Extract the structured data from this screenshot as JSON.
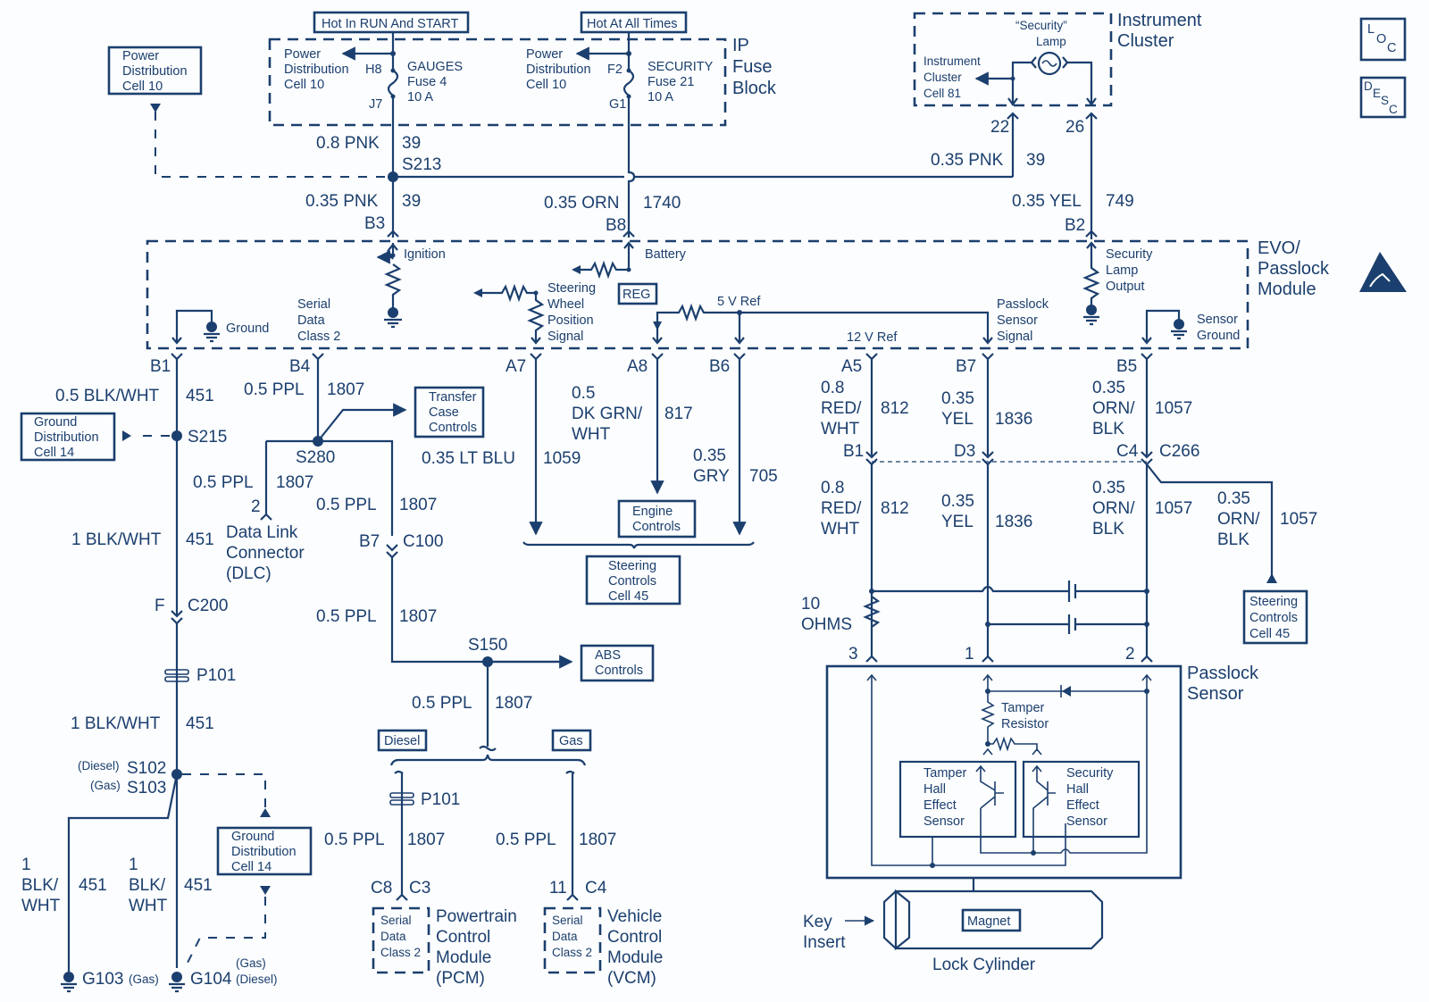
{
  "diagram": {
    "title": "EVO/Passlock Module wiring schematic",
    "colors": {
      "ink": "#1b3f6e",
      "background": "#fcfdfe"
    },
    "icons": {
      "loc": "LOC",
      "desc": "DESC",
      "esd": "esd-warning-icon"
    },
    "power_labels": {
      "hot_run_start": "Hot In RUN And START",
      "hot_all_times": "Hot At All Times"
    },
    "ip_fuse_block": {
      "title": [
        "IP",
        "Fuse",
        "Block"
      ],
      "left_ref": [
        "Power",
        "Distribution",
        "Cell 10"
      ],
      "right_ref": [
        "Power",
        "Distribution",
        "Cell 10"
      ],
      "gauges_fuse": {
        "name": "GAUGES",
        "fuse": "Fuse 4",
        "rating": "10 A",
        "in_pin": "H8",
        "out_pin": "J7"
      },
      "security_fuse": {
        "name": "SECURITY",
        "fuse": "Fuse 21",
        "rating": "10 A",
        "in_pin": "F2",
        "out_pin": "G1"
      }
    },
    "power_dist_box": [
      "Power",
      "Distribution",
      "Cell 10"
    ],
    "instrument_cluster": {
      "title": [
        "Instrument",
        "Cluster"
      ],
      "lamp": [
        "“Security”",
        "Lamp"
      ],
      "ref": [
        "Instrument",
        "Cluster",
        "Cell 81"
      ],
      "pins": [
        "22",
        "26"
      ]
    },
    "wires_top": {
      "w1": {
        "gauge": "0.8 PNK",
        "circuit": "39",
        "splice": "S213"
      },
      "w2": {
        "gauge": "0.35 PNK",
        "circuit": "39",
        "pin": "B3"
      },
      "w3": {
        "gauge": "0.35 ORN",
        "circuit": "1740",
        "pin": "B8"
      },
      "w4": {
        "gauge": "0.35 PNK",
        "circuit": "39"
      },
      "w5": {
        "gauge": "0.35 YEL",
        "circuit": "749",
        "pin": "B2"
      }
    },
    "evo_module": {
      "title": [
        "EVO/",
        "Passlock",
        "Module"
      ],
      "ignition": "Ignition",
      "battery": "Battery",
      "reg": "REG",
      "ground": "Ground",
      "serial": [
        "Serial",
        "Data",
        "Class 2"
      ],
      "steering": [
        "Steering",
        "Wheel",
        "Position",
        "Signal"
      ],
      "five_v": "5 V Ref",
      "twelve_v": "12 V Ref",
      "passlock_signal": [
        "Passlock",
        "Sensor",
        "Signal"
      ],
      "security_lamp": [
        "Security",
        "Lamp",
        "Output"
      ],
      "sensor_ground": [
        "Sensor",
        "Ground"
      ],
      "pins": [
        "B1",
        "B4",
        "A7",
        "A8",
        "B6",
        "A5",
        "B7",
        "B5"
      ]
    },
    "left": {
      "w_b1": {
        "gauge": "0.5 BLK/WHT",
        "circuit": "451"
      },
      "s215": "S215",
      "ground_box": [
        "Ground",
        "Distribution",
        "Cell 14"
      ],
      "w_451b": {
        "gauge": "1 BLK/WHT",
        "circuit": "451"
      },
      "c200": {
        "pin": "F",
        "name": "C200"
      },
      "p101": "P101",
      "w_451c": {
        "gauge": "1 BLK/WHT",
        "circuit": "451"
      },
      "s102": {
        "tag": "(Diesel)",
        "name": "S102"
      },
      "s103": {
        "tag": "(Gas)",
        "name": "S103"
      },
      "w_451d": {
        "gauge": [
          "1",
          "BLK/",
          "WHT"
        ],
        "circuit": "451"
      },
      "w_451e": {
        "gauge": [
          "1",
          "BLK/",
          "WHT"
        ],
        "circuit": "451"
      },
      "ground_box2": [
        "Ground",
        "Distribution",
        "Cell 14"
      ],
      "g103": {
        "name": "G103",
        "tag": "(Gas)"
      },
      "g104": {
        "name": "G104",
        "tag1": "(Gas)",
        "tag2": "(Diesel)"
      }
    },
    "serial": {
      "w_b4": {
        "gauge": "0.5 PPL",
        "circuit": "1807"
      },
      "s280": "S280",
      "transfer_box": [
        "Transfer",
        "Case",
        "Controls"
      ],
      "w_dlc": {
        "gauge": "0.5 PPL",
        "circuit": "1807"
      },
      "dlc_pin": "2",
      "dlc": [
        "Data Link",
        "Connector",
        "(DLC)"
      ],
      "w_c100a": {
        "gauge": "0.5 PPL",
        "circuit": "1807"
      },
      "c100": {
        "pin": "B7",
        "name": "C100"
      },
      "w_c100b": {
        "gauge": "0.5 PPL",
        "circuit": "1807"
      },
      "s150": "S150",
      "abs_box": [
        "ABS",
        "Controls"
      ],
      "w_s150": {
        "gauge": "0.5 PPL",
        "circuit": "1807"
      },
      "diesel": "Diesel",
      "gas": "Gas",
      "p101": "P101",
      "w_pcm": {
        "gauge": "0.5 PPL",
        "circuit": "1807"
      },
      "w_vcm": {
        "gauge": "0.5 PPL",
        "circuit": "1807"
      },
      "pcm_pins": {
        "a": "C8",
        "b": "C3"
      },
      "vcm_pins": {
        "a": "11",
        "b": "C4"
      },
      "pcm_inner": [
        "Serial",
        "Data",
        "Class 2"
      ],
      "vcm_inner": [
        "Serial",
        "Data",
        "Class 2"
      ],
      "pcm": [
        "Powertrain",
        "Control",
        "Module",
        "(PCM)"
      ],
      "vcm": [
        "Vehicle",
        "Control",
        "Module",
        "(VCM)"
      ]
    },
    "mid": {
      "w_a7": {
        "gauge": "0.35 LT BLU",
        "circuit": "1059"
      },
      "w_a8": {
        "gauge": [
          "0.5",
          "DK GRN/",
          "WHT"
        ],
        "circuit": "817"
      },
      "w_b6": {
        "gauge": [
          "0.35",
          "GRY"
        ],
        "circuit": "705"
      },
      "engine_box": [
        "Engine",
        "Controls"
      ],
      "steering_box": [
        "Steering",
        "Controls",
        "Cell 45"
      ]
    },
    "right": {
      "w_a5": {
        "gauge": [
          "0.8",
          "RED/",
          "WHT"
        ],
        "circuit": "812"
      },
      "w_b7": {
        "gauge": [
          "0.35",
          "YEL"
        ],
        "circuit": "1836"
      },
      "w_b5": {
        "gauge": [
          "0.35",
          "ORN/",
          "BLK"
        ],
        "circuit": "1057"
      },
      "c266_pins": [
        "B1",
        "D3",
        "C4"
      ],
      "c266": "C266",
      "w_a5b": {
        "gauge": [
          "0.8",
          "RED/",
          "WHT"
        ],
        "circuit": "812"
      },
      "w_b7b": {
        "gauge": [
          "0.35",
          "YEL"
        ],
        "circuit": "1836"
      },
      "w_b5b": {
        "gauge": [
          "0.35",
          "ORN/",
          "BLK"
        ],
        "circuit": "1057"
      },
      "w_steer": {
        "gauge": [
          "0.35",
          "ORN/",
          "BLK"
        ],
        "circuit": "1057"
      },
      "steering_box": [
        "Steering",
        "Controls",
        "Cell 45"
      ],
      "resistor": [
        "10",
        "OHMS"
      ],
      "sensor_pins": [
        "3",
        "1",
        "2"
      ]
    },
    "passlock_sensor": {
      "title": [
        "Passlock",
        "Sensor"
      ],
      "tamper_resistor": [
        "Tamper",
        "Resistor"
      ],
      "tamper_hall": [
        "Tamper",
        "Hall",
        "Effect",
        "Sensor"
      ],
      "security_hall": [
        "Security",
        "Hall",
        "Effect",
        "Sensor"
      ],
      "key_insert": [
        "Key",
        "Insert"
      ],
      "magnet": "Magnet",
      "lock_cylinder": "Lock Cylinder"
    }
  }
}
